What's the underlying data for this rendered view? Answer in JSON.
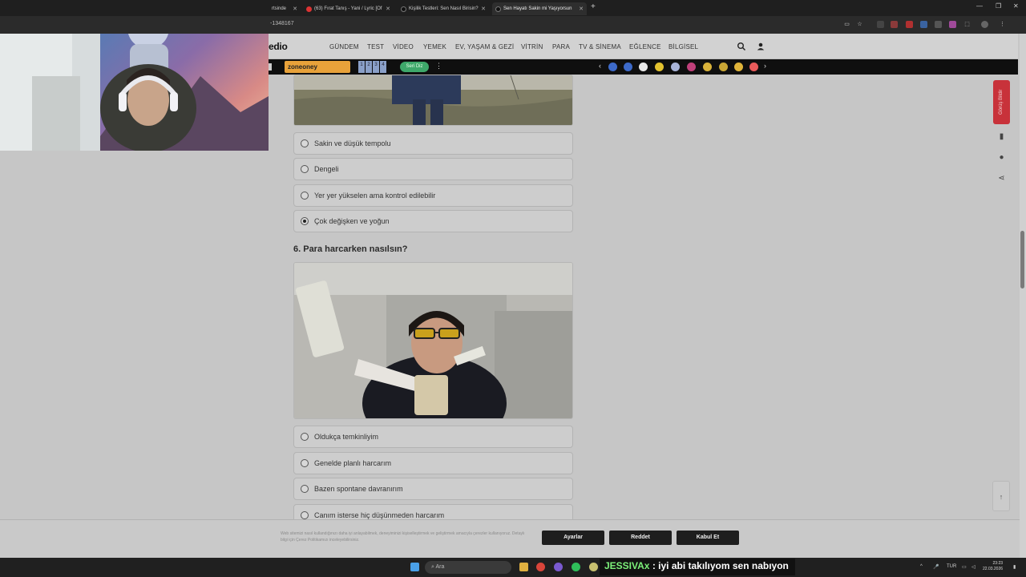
{
  "browser": {
    "tabs": [
      {
        "label": "rtsinde"
      },
      {
        "label": "(63) Fırat Tanış - Yani / Lyric [Of"
      },
      {
        "label": "Kişilik Testleri: Sen Nasıl Birisin?"
      },
      {
        "label": "Sen Hayatı Sakin mi Yaşıyorsun"
      }
    ],
    "url_fragment": "-1348167"
  },
  "site": {
    "logo": "edio",
    "nav": [
      "GÜNDEM",
      "TEST",
      "VİDEO",
      "YEMEK",
      "EV, YAŞAM & GEZİ",
      "VİTRİN",
      "PARA",
      "TV & SİNEMA",
      "EĞLENCE",
      "BİLGİSEL"
    ],
    "zone_label": "zoneoney",
    "page_numbers": [
      "1",
      "2",
      "3",
      "4"
    ],
    "seri_label": "Seri Diz"
  },
  "question5": {
    "options": [
      {
        "label": "Sakin ve düşük tempolu",
        "checked": false
      },
      {
        "label": "Dengeli",
        "checked": false
      },
      {
        "label": "Yer yer yükselen ama kontrol edilebilir",
        "checked": false
      },
      {
        "label": "Çok değişken ve yoğun",
        "checked": true
      }
    ]
  },
  "question6": {
    "title": "6. Para harcarken nasılsın?",
    "options": [
      {
        "label": "Oldukça temkinliyim",
        "checked": false
      },
      {
        "label": "Genelde planlı harcarım",
        "checked": false
      },
      {
        "label": "Bazen spontane davranırım",
        "checked": false
      },
      {
        "label": "Canım isterse hiç düşünmeden harcarım",
        "checked": false
      }
    ]
  },
  "sidebar": {
    "feedback_label": "Görüş Bildir"
  },
  "cookie": {
    "text": "Web sitemizi nasıl kullandığınızı daha iyi anlayabilmek, deneyiminizi kişiselleştirmek ve geliştirmek amacıyla çerezler kullanıyoruz. Detaylı bilgi için Çerez Politikamızı inceleyebilirsiniz.",
    "settings_label": "Ayarlar",
    "reject_label": "Reddet",
    "accept_label": "Kabul Et"
  },
  "taskbar": {
    "search_placeholder": "Ara",
    "lang": "TUR",
    "time": "23:23",
    "date": "22.03.2026"
  },
  "chat_overlay": {
    "user": "JESSIVAx",
    "message": " : iyi abi takılıyom sen nabıyon"
  },
  "colors": {
    "feedback": "#c8323a",
    "chat_user": "#7cf07a",
    "seri": "#3ea86a",
    "zone": "#e8a23a"
  }
}
